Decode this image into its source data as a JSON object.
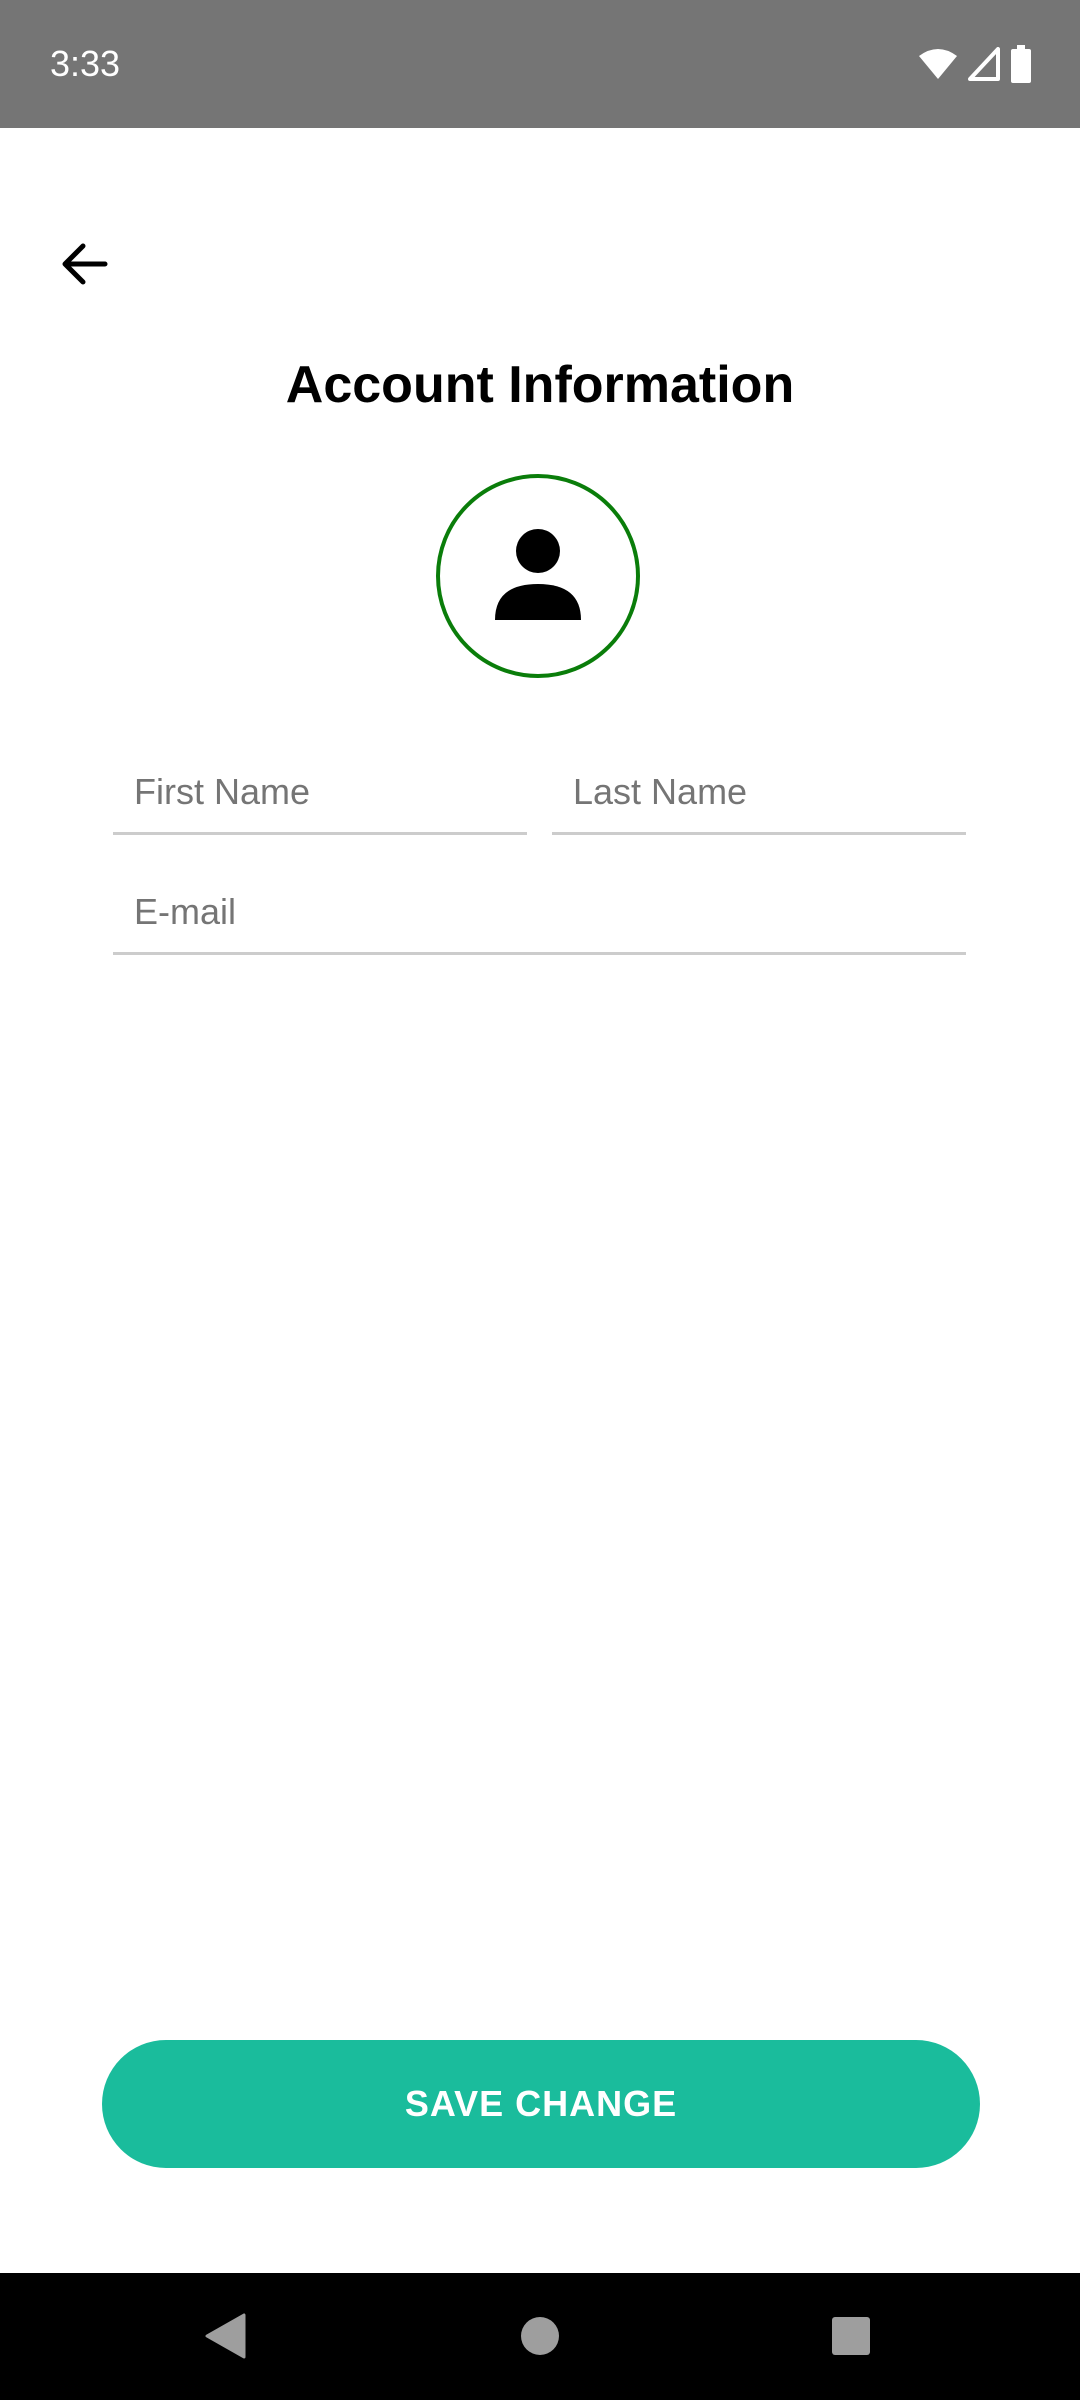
{
  "status_bar": {
    "time": "3:33",
    "icons": [
      "wifi-icon",
      "cell-signal-icon",
      "battery-icon"
    ]
  },
  "header": {
    "back_icon": "arrow-left-icon",
    "title": "Account Information"
  },
  "avatar": {
    "icon": "person-icon",
    "border_color": "#0a7d0a"
  },
  "form": {
    "first_name": {
      "value": "",
      "placeholder": "First Name"
    },
    "last_name": {
      "value": "",
      "placeholder": "Last Name"
    },
    "email": {
      "value": "",
      "placeholder": "E-mail"
    }
  },
  "actions": {
    "save_label": "SAVE CHANGE",
    "save_color": "#1abc9c"
  },
  "nav_bar": {
    "buttons": [
      "back-triangle-icon",
      "home-circle-icon",
      "recents-square-icon"
    ]
  }
}
